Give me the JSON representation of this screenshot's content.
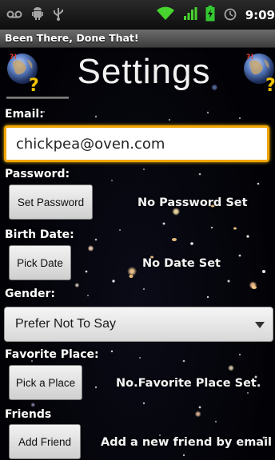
{
  "status_bar": {
    "icons": [
      "voicemail-icon",
      "android-debug-icon",
      "usb-icon",
      "wifi-icon",
      "signal-icon",
      "battery-icon",
      "alarm-icon"
    ],
    "time": "9:09"
  },
  "app": {
    "title": "Been There, Done That!"
  },
  "header": {
    "title": "Settings"
  },
  "email": {
    "label": "Email:",
    "value": "chickpea@oven.com"
  },
  "password": {
    "label": "Password:",
    "button": "Set Password",
    "status": "No Password Set"
  },
  "birth_date": {
    "label": "Birth Date:",
    "button": "Pick Date",
    "status": "No Date Set"
  },
  "gender": {
    "label": "Gender:",
    "selected": "Prefer Not To Say"
  },
  "favorite_place": {
    "label": "Favorite Place:",
    "button": "Pick a Place",
    "status": "No.Favorite Place Set."
  },
  "friends": {
    "label": "Friends",
    "button": "Add Friend",
    "status": "Add a new friend by email"
  },
  "colors": {
    "accent_focus": "#f0a500",
    "battery": "#34c832",
    "signal": "#48d42e"
  }
}
